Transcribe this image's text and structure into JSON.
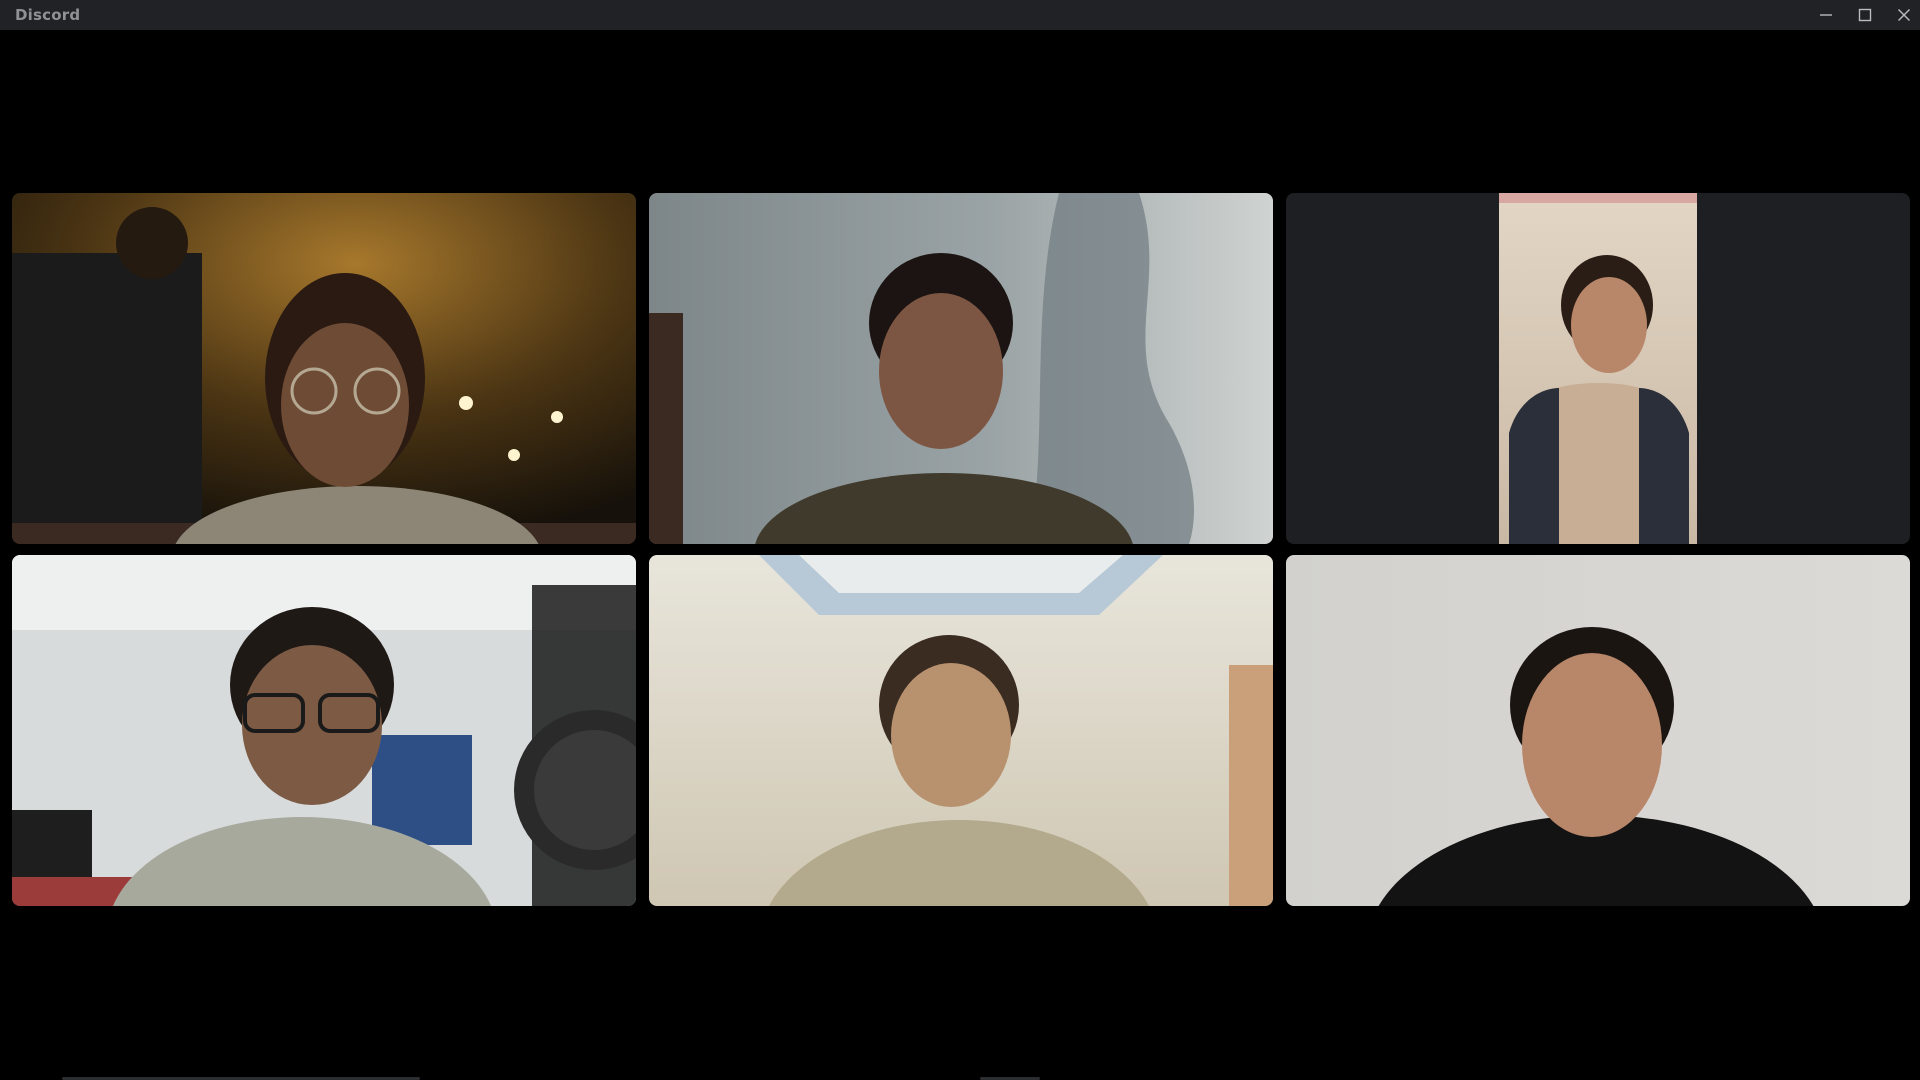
{
  "window": {
    "title": "Discord",
    "controls": [
      "minimize-icon",
      "maximize-icon",
      "close-icon"
    ]
  },
  "colors": {
    "titlebar_bg": "#202225",
    "title_text": "#8e9297",
    "stage_bg": "#000000",
    "tile_bg": "#1e1f22"
  },
  "call": {
    "participant_count": 6,
    "layout": "grid-3x2"
  }
}
